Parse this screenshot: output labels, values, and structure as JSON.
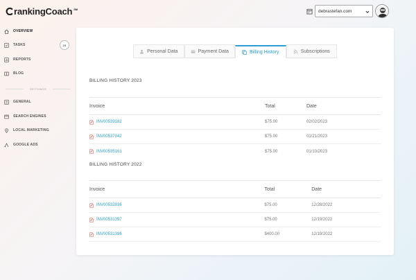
{
  "brand": {
    "name": "rankingCoach",
    "mark": "SM"
  },
  "sidebar": {
    "items": [
      {
        "label": "OVERVIEW",
        "icon": "home-icon",
        "active": true
      },
      {
        "label": "TASKS",
        "icon": "checkbox-icon",
        "badge": "23"
      },
      {
        "label": "REPORTS",
        "icon": "chart-icon"
      },
      {
        "label": "BLOG",
        "icon": "book-icon"
      }
    ],
    "settings_label": "SETTINGS",
    "settings_items": [
      {
        "label": "GENERAL",
        "icon": "sliders-icon"
      },
      {
        "label": "SEARCH ENGINES",
        "icon": "search-engine-icon"
      },
      {
        "label": "LOCAL MARKETING",
        "icon": "map-pin-icon"
      },
      {
        "label": "GOOGLE ADS",
        "icon": "ads-icon"
      }
    ]
  },
  "topbar": {
    "account": "debrastefan.com"
  },
  "tabs": [
    {
      "label": "Personal Data",
      "icon": "person-icon"
    },
    {
      "label": "Payment Data",
      "icon": "card-icon"
    },
    {
      "label": "Billing History",
      "icon": "copy-icon",
      "active": true
    },
    {
      "label": "Subscriptions",
      "icon": "rss-icon"
    }
  ],
  "billing": [
    {
      "title": "BILLING HISTORY 2023",
      "columns": [
        "Invoice",
        "Total",
        "Date"
      ],
      "rows": [
        {
          "invoice": "INV00539182",
          "total": "$75.00",
          "date": "02/02/2023"
        },
        {
          "invoice": "INV00537042",
          "total": "$75.00",
          "date": "01/21/2023"
        },
        {
          "invoice": "INV00535161",
          "total": "$75.00",
          "date": "01/10/2023"
        }
      ]
    },
    {
      "title": "BILLING HISTORY 2022",
      "columns": [
        "Invoice",
        "Total",
        "Date"
      ],
      "rows": [
        {
          "invoice": "INV00532936",
          "total": "$75.00",
          "date": "12/28/2022"
        },
        {
          "invoice": "INV00531397",
          "total": "$75.00",
          "date": "12/19/2022"
        },
        {
          "invoice": "INV00531396",
          "total": "$400.00",
          "date": "12/19/2022"
        }
      ]
    }
  ],
  "colors": {
    "accent": "#2a9fd6",
    "pdf": "#e2574c"
  }
}
